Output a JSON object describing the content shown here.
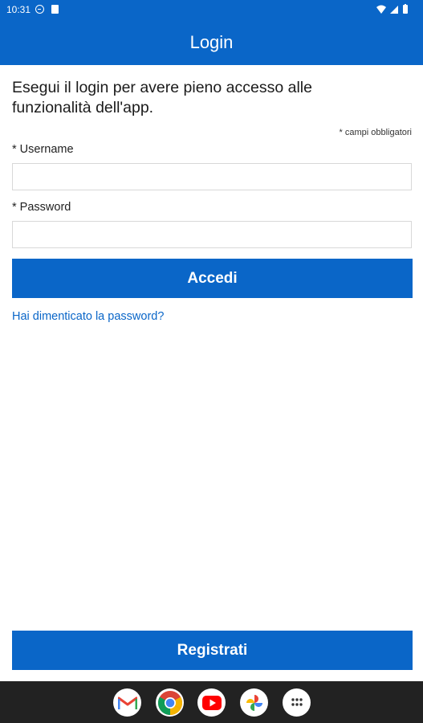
{
  "status_bar": {
    "time": "10:31",
    "icons": [
      "data-saver-icon",
      "sim-card-icon",
      "wifi-icon",
      "cellular-signal-icon",
      "battery-icon"
    ]
  },
  "app_bar": {
    "title": "Login"
  },
  "login_form": {
    "intro_text": "Esegui il login per avere pieno accesso alle funzionalità dell'app.",
    "required_note": "* campi obbligatori",
    "username_label": "* Username",
    "username_value": "",
    "password_label": "* Password",
    "password_value": "",
    "submit_label": "Accedi",
    "forgot_password_link": "Hai dimenticato la password?"
  },
  "footer": {
    "register_label": "Registrati"
  },
  "dock": {
    "apps": [
      "gmail-icon",
      "chrome-icon",
      "youtube-icon",
      "photos-icon",
      "app-drawer-icon"
    ]
  },
  "colors": {
    "primary": "#0a66c8",
    "navbar": "#222222",
    "text": "#1b1b1b",
    "input_border": "#d8d8d8"
  }
}
